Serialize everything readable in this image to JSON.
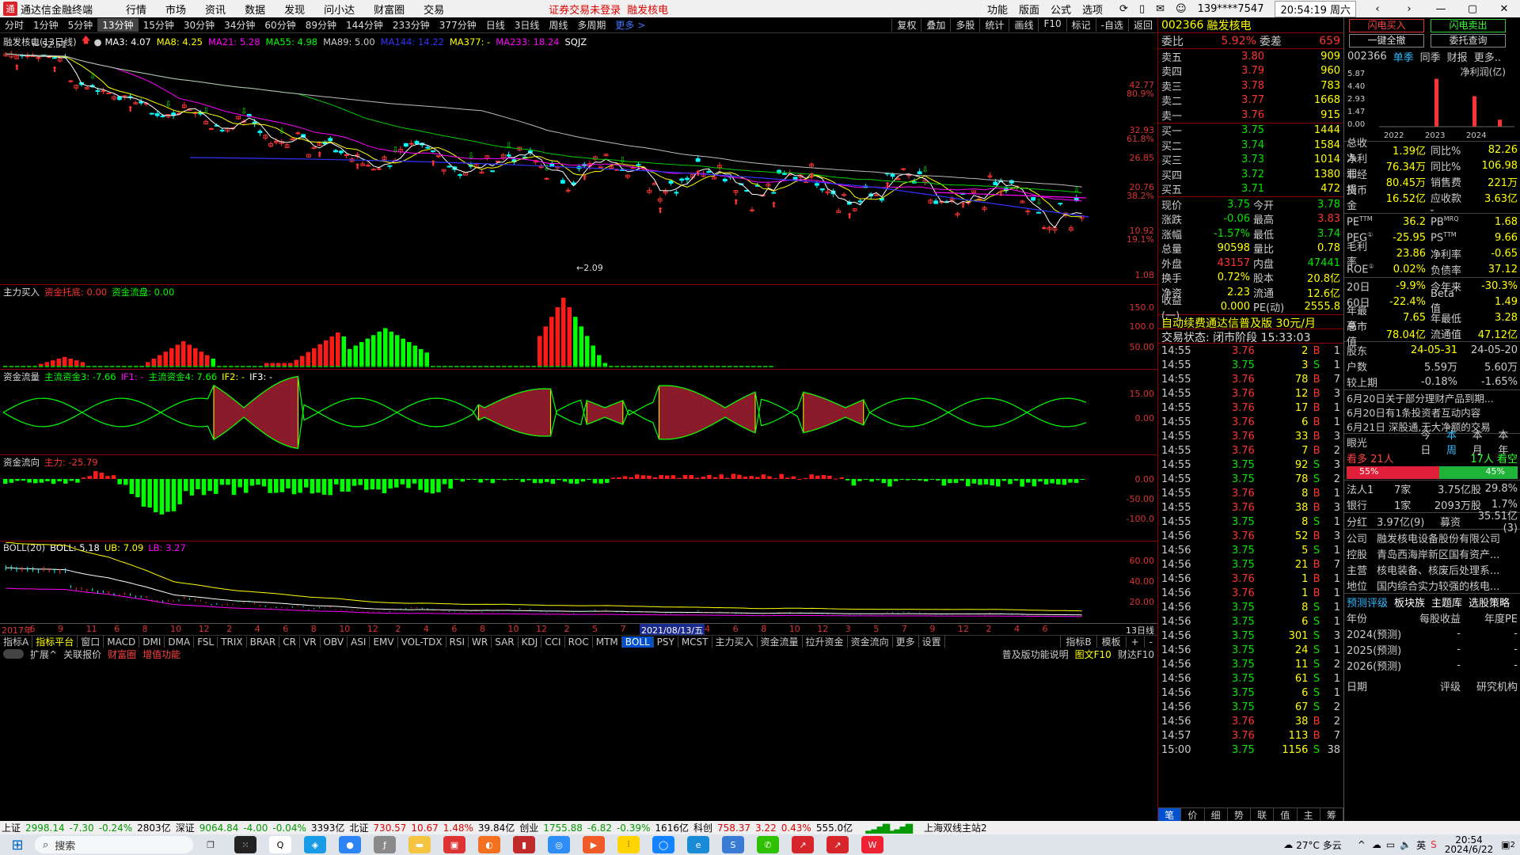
{
  "app": {
    "title": "通达信金融终端",
    "menu": [
      "行情",
      "市场",
      "资讯",
      "数据",
      "发现",
      "问小达",
      "财富圈",
      "交易"
    ],
    "warning": "证券交易未登录",
    "warning_stock": "融发核电",
    "right": [
      "功能",
      "版面",
      "公式",
      "选项"
    ],
    "account": "139****7547",
    "clock": "20:54:19 周六"
  },
  "periods": [
    "分时",
    "1分钟",
    "5分钟",
    "13分钟",
    "15分钟",
    "30分钟",
    "34分钟",
    "60分钟",
    "89分钟",
    "144分钟",
    "233分钟",
    "377分钟",
    "日线",
    "3日线",
    "周线",
    "多周期",
    "更多 >"
  ],
  "period_active": "13分钟",
  "tools": [
    "复权",
    "叠加",
    "多股",
    "统计",
    "画线",
    "F10",
    "标记",
    "-自选",
    "返回"
  ],
  "main": {
    "head_title": "融发核电(13日线)",
    "ma": [
      {
        "t": "MA3: 4.07",
        "c": "#ffffff"
      },
      {
        "t": "MA8: 4.25",
        "c": "#ffff00"
      },
      {
        "t": "MA21: 5.28",
        "c": "#ff00ff"
      },
      {
        "t": "MA55: 4.98",
        "c": "#00ff00"
      },
      {
        "t": "MA89: 5.00",
        "c": "#cccccc"
      },
      {
        "t": "MA144: 14.22",
        "c": "#3333ff"
      },
      {
        "t": "MA377: -",
        "c": "#ffff00"
      },
      {
        "t": "MA233: 18.24",
        "c": "#ff00ff"
      },
      {
        "t": "SQJZ",
        "c": "#ffffff"
      }
    ],
    "high_label": "52.51",
    "low_label": "2.09",
    "yticks": [
      {
        "v": "42.77",
        "p": "80.9%"
      },
      {
        "v": "32.93",
        "p": "61.8%"
      },
      {
        "v": "26.85",
        "p": ""
      },
      {
        "v": "20.76",
        "p": "38.2%"
      },
      {
        "v": "10.92",
        "p": "19.1%"
      },
      {
        "v": "1.08",
        "p": ""
      }
    ]
  },
  "pane2": {
    "title": "主力买入",
    "items": [
      {
        "t": "资金托底: 0.00",
        "c": "#ff3333"
      },
      {
        "t": "资金流盘: 0.00",
        "c": "#00ff00"
      }
    ],
    "yticks": [
      "150.0",
      "100.0",
      "50.00"
    ]
  },
  "pane3": {
    "title": "资金流量",
    "items": [
      {
        "t": "主流资金3: -7.66",
        "c": "#00ff00"
      },
      {
        "t": "IF1: -",
        "c": "#ff00ff"
      },
      {
        "t": "主流资金4: 7.66",
        "c": "#00ff00"
      },
      {
        "t": "IF2: -",
        "c": "#ffff00"
      },
      {
        "t": "IF3: -",
        "c": "#ffffff"
      }
    ],
    "yticks": [
      "15.00",
      "0.00"
    ]
  },
  "pane4": {
    "title": "资金流向",
    "items": [
      {
        "t": "主力: -25.79",
        "c": "#ff3333"
      }
    ],
    "yticks": [
      "0.00",
      "-50.00",
      "-100.0"
    ]
  },
  "pane5": {
    "title": "BOLL(20)",
    "items": [
      {
        "t": "BOLL: 5.18",
        "c": "#ffffff"
      },
      {
        "t": "UB: 7.09",
        "c": "#ffff00"
      },
      {
        "t": "LB: 3.27",
        "c": "#ff00ff"
      }
    ],
    "yticks": [
      "60.00",
      "40.00",
      "20.00"
    ]
  },
  "xaxis": [
    "2017年",
    "6",
    "9",
    "11",
    "6",
    "8",
    "10",
    "12",
    "2",
    "4",
    "6",
    "8",
    "10",
    "12",
    "2",
    "4",
    "6",
    "8",
    "10",
    "12",
    "2",
    "5",
    "7",
    "9",
    "11",
    "4",
    "6",
    "8",
    "10",
    "12",
    "3",
    "5",
    "7",
    "9",
    "12",
    "2",
    "4",
    "6"
  ],
  "xaxis_highlight": "2021/08/13/五",
  "xaxis_unit": "13日线",
  "indicator_tabs": [
    "指标A",
    "指标平台",
    "窗口",
    "MACD",
    "DMI",
    "DMA",
    "FSL",
    "TRIX",
    "BRAR",
    "CR",
    "VR",
    "OBV",
    "ASI",
    "EMV",
    "VOL-TDX",
    "RSI",
    "WR",
    "SAR",
    "KDJ",
    "CCI",
    "ROC",
    "MTM",
    "BOLL",
    "PSY",
    "MCST",
    "主力买入",
    "资金流量",
    "拉升资金",
    "资金流向",
    "更多",
    "设置"
  ],
  "indicator_active": "BOLL",
  "indicator_right": [
    "指标B",
    "模板",
    "+",
    "-"
  ],
  "sub_tabs": [
    "扩展^",
    "关联报价",
    "财富圈",
    "增值功能"
  ],
  "sub_right": [
    "普及版功能说明",
    "图文F10",
    "财达F10"
  ],
  "quote": {
    "code": "002366",
    "name": "融发核电",
    "weibi_label": "委比",
    "weibi": "5.92%",
    "weicha_label": "委差",
    "weicha": "659",
    "asks": [
      {
        "l": "卖五",
        "p": "3.80",
        "v": "909"
      },
      {
        "l": "卖四",
        "p": "3.79",
        "v": "960"
      },
      {
        "l": "卖三",
        "p": "3.78",
        "v": "783"
      },
      {
        "l": "卖二",
        "p": "3.77",
        "v": "1668"
      },
      {
        "l": "卖一",
        "p": "3.76",
        "v": "915"
      }
    ],
    "bids": [
      {
        "l": "买一",
        "p": "3.75",
        "v": "1444"
      },
      {
        "l": "买二",
        "p": "3.74",
        "v": "1584"
      },
      {
        "l": "买三",
        "p": "3.73",
        "v": "1014"
      },
      {
        "l": "买四",
        "p": "3.72",
        "v": "1380"
      },
      {
        "l": "买五",
        "p": "3.71",
        "v": "472"
      }
    ],
    "stats": [
      {
        "k": "现价",
        "v": "3.75",
        "vc": "#00e600",
        "k2": "今开",
        "v2": "3.78",
        "v2c": "#00e600"
      },
      {
        "k": "涨跌",
        "v": "-0.06",
        "vc": "#00e600",
        "k2": "最高",
        "v2": "3.83",
        "v2c": "#ff3333"
      },
      {
        "k": "涨幅",
        "v": "-1.57%",
        "vc": "#00e600",
        "k2": "最低",
        "v2": "3.74",
        "v2c": "#00e600"
      },
      {
        "k": "总量",
        "v": "90598",
        "vc": "#ffff00",
        "k2": "量比",
        "v2": "0.78",
        "v2c": "#ffff00"
      },
      {
        "k": "外盘",
        "v": "43157",
        "vc": "#ff3333",
        "k2": "内盘",
        "v2": "47441",
        "v2c": "#00e600"
      },
      {
        "k": "换手",
        "v": "0.72%",
        "vc": "#ffff00",
        "k2": "股本",
        "v2": "20.8亿",
        "v2c": "#ffff00"
      },
      {
        "k": "净资",
        "v": "2.23",
        "vc": "#ffff00",
        "k2": "流通",
        "v2": "12.6亿",
        "v2c": "#ffff00"
      },
      {
        "k": "收益(一)",
        "v": "0.000",
        "vc": "#ffff00",
        "k2": "PE(动)",
        "v2": "2555.8",
        "v2c": "#ffff00"
      }
    ],
    "banner": "自动续费通达信普及版  30元/月",
    "trade_status": "交易状态: 闭市阶段 15:33:03",
    "ticks": [
      {
        "t": "14:55",
        "p": "3.76",
        "v": "2",
        "d": "B",
        "n": "1"
      },
      {
        "t": "14:55",
        "p": "3.75",
        "v": "3",
        "d": "S",
        "n": "1"
      },
      {
        "t": "14:55",
        "p": "3.76",
        "v": "78",
        "d": "B",
        "n": "7"
      },
      {
        "t": "14:55",
        "p": "3.76",
        "v": "12",
        "d": "B",
        "n": "3"
      },
      {
        "t": "14:55",
        "p": "3.76",
        "v": "17",
        "d": "B",
        "n": "1"
      },
      {
        "t": "14:55",
        "p": "3.76",
        "v": "6",
        "d": "B",
        "n": "1"
      },
      {
        "t": "14:55",
        "p": "3.76",
        "v": "33",
        "d": "B",
        "n": "3"
      },
      {
        "t": "14:55",
        "p": "3.76",
        "v": "7",
        "d": "B",
        "n": "2"
      },
      {
        "t": "14:55",
        "p": "3.75",
        "v": "92",
        "d": "S",
        "n": "3"
      },
      {
        "t": "14:55",
        "p": "3.75",
        "v": "78",
        "d": "S",
        "n": "2"
      },
      {
        "t": "14:55",
        "p": "3.76",
        "v": "8",
        "d": "B",
        "n": "1"
      },
      {
        "t": "14:55",
        "p": "3.76",
        "v": "38",
        "d": "B",
        "n": "3"
      },
      {
        "t": "14:55",
        "p": "3.75",
        "v": "8",
        "d": "S",
        "n": "1"
      },
      {
        "t": "14:56",
        "p": "3.76",
        "v": "52",
        "d": "B",
        "n": "3"
      },
      {
        "t": "14:56",
        "p": "3.75",
        "v": "5",
        "d": "S",
        "n": "1"
      },
      {
        "t": "14:56",
        "p": "3.75",
        "v": "21",
        "d": "B",
        "n": "7"
      },
      {
        "t": "14:56",
        "p": "3.76",
        "v": "1",
        "d": "B",
        "n": "1"
      },
      {
        "t": "14:56",
        "p": "3.76",
        "v": "1",
        "d": "B",
        "n": "1"
      },
      {
        "t": "14:56",
        "p": "3.75",
        "v": "8",
        "d": "S",
        "n": "1"
      },
      {
        "t": "14:56",
        "p": "3.75",
        "v": "6",
        "d": "S",
        "n": "1"
      },
      {
        "t": "14:56",
        "p": "3.75",
        "v": "301",
        "d": "S",
        "n": "3"
      },
      {
        "t": "14:56",
        "p": "3.75",
        "v": "24",
        "d": "S",
        "n": "1"
      },
      {
        "t": "14:56",
        "p": "3.75",
        "v": "11",
        "d": "S",
        "n": "2"
      },
      {
        "t": "14:56",
        "p": "3.75",
        "v": "61",
        "d": "S",
        "n": "1"
      },
      {
        "t": "14:56",
        "p": "3.75",
        "v": "6",
        "d": "S",
        "n": "1"
      },
      {
        "t": "14:56",
        "p": "3.75",
        "v": "67",
        "d": "S",
        "n": "2"
      },
      {
        "t": "14:56",
        "p": "3.76",
        "v": "38",
        "d": "B",
        "n": "2"
      },
      {
        "t": "14:57",
        "p": "3.76",
        "v": "113",
        "d": "B",
        "n": "7"
      },
      {
        "t": "15:00",
        "p": "3.75",
        "v": "1156",
        "d": "S",
        "n": "38"
      }
    ],
    "bottom_tabs": [
      "笔",
      "价",
      "细",
      "势",
      "联",
      "值",
      "主",
      "筹"
    ]
  },
  "far": {
    "buttons": [
      "闪电买入",
      "闪电卖出",
      "一键全撤",
      "委托查询"
    ],
    "tabs": [
      "002366",
      "单季",
      "同季",
      "财报",
      "更多.."
    ],
    "chart_title": "净利润(亿)",
    "chart_y": [
      "5.87",
      "4.40",
      "2.93",
      "1.47",
      "0.00"
    ],
    "chart_x": [
      "2022",
      "2023",
      "2024"
    ],
    "fin": [
      {
        "k": "总收入",
        "v": "1.39亿",
        "k2": "同比%",
        "v2": "82.26"
      },
      {
        "k": "净利润",
        "v": "76.34万",
        "k2": "同比%",
        "v2": "106.98"
      },
      {
        "k": "非经损",
        "v": "80.45万",
        "k2": "销售费",
        "v2": "221万"
      },
      {
        "k": "货币金",
        "v": "16.52亿",
        "k2": "应收款",
        "v2": "3.63亿"
      }
    ],
    "val": [
      {
        "k": "PE",
        "sup": "TTM",
        "v": "36.2",
        "k2": "PB",
        "sup2": "MRQ",
        "v2": "1.68"
      },
      {
        "k": "PEG",
        "sup": "①",
        "v": "-25.95",
        "k2": "PS",
        "sup2": "TTM",
        "v2": "9.66"
      },
      {
        "k": "毛利率",
        "sup": "",
        "v": "23.86",
        "k2": "净利率",
        "sup2": "",
        "v2": "-0.65"
      },
      {
        "k": "ROE",
        "sup": "①",
        "v": "0.02%",
        "k2": "负债率",
        "sup2": "",
        "v2": "37.12"
      }
    ],
    "perf": [
      {
        "k": "20日",
        "v": "-9.9%",
        "k2": "今年来",
        "v2": "-30.3%"
      },
      {
        "k": "60日",
        "v": "-22.4%",
        "k2": "Beta值",
        "v2": "1.49"
      },
      {
        "k": "年最高",
        "v": "7.65",
        "k2": "年最低",
        "v2": "3.28"
      },
      {
        "k": "总市值",
        "v": "78.04亿",
        "k2": "流通值",
        "v2": "47.12亿"
      }
    ],
    "holders": {
      "k": "股东",
      "d1": "24-05-31",
      "d2": "24-05-20",
      "rows": [
        {
          "k": "户数",
          "v1": "5.59万",
          "v2": "5.60万"
        },
        {
          "k": "较上期",
          "v1": "-0.18%",
          "v2": "-1.65%"
        }
      ]
    },
    "news": [
      "6月20日关于部分理财产品到期...",
      "6月20日有1条投资者互动内容",
      "6月21日 深股通,无大净额的交易"
    ],
    "eye": {
      "label": "眼光",
      "tabs": [
        "今日",
        "本周",
        "本月",
        "本年"
      ],
      "bull": "看多 21人",
      "bear": "17人 看空",
      "bull_pct": "55%",
      "bear_pct": "45%"
    },
    "inst": [
      {
        "k": "法人1",
        "v": "7家",
        "v2": "3.75亿股",
        "v3": "29.8%"
      },
      {
        "k": "银行",
        "v": "1家",
        "v2": "2093万股",
        "v3": "1.7%"
      }
    ],
    "fenhong": {
      "k": "分红",
      "v": "3.97亿(9)",
      "k2": "募资",
      "v2": "35.51亿(3)"
    },
    "company": [
      {
        "k": "公司",
        "v": "融发核电设备股份有限公司"
      },
      {
        "k": "控股",
        "v": "青岛西海岸新区国有资产..."
      },
      {
        "k": "主营",
        "v": "核电装备、核废后处理系..."
      },
      {
        "k": "地位",
        "v": "国内综合实力较强的核电..."
      }
    ],
    "forecast_tabs": [
      "预测评级",
      "板块族",
      "主题库",
      "选股策略"
    ],
    "forecast_head": [
      "年份",
      "每股收益",
      "年度PE"
    ],
    "forecast_rows": [
      {
        "y": "2024(预测)",
        "e": "-",
        "p": "-"
      },
      {
        "y": "2025(预测)",
        "e": "-",
        "p": "-"
      },
      {
        "y": "2026(预测)",
        "e": "-",
        "p": "-"
      }
    ],
    "rating_head": [
      "日期",
      "评级",
      "研究机构"
    ]
  },
  "status": {
    "items": [
      {
        "t": "上证",
        "c": "#000"
      },
      {
        "t": "2998.14",
        "c": "#090"
      },
      {
        "t": "-7.30",
        "c": "#090"
      },
      {
        "t": "-0.24%",
        "c": "#090"
      },
      {
        "t": "2803亿",
        "c": "#000"
      },
      {
        "t": "深证",
        "c": "#000"
      },
      {
        "t": "9064.84",
        "c": "#090"
      },
      {
        "t": "-4.00",
        "c": "#090"
      },
      {
        "t": "-0.04%",
        "c": "#090"
      },
      {
        "t": "3393亿",
        "c": "#000"
      },
      {
        "t": "北证",
        "c": "#000"
      },
      {
        "t": "730.57",
        "c": "#d00"
      },
      {
        "t": "10.67",
        "c": "#d00"
      },
      {
        "t": "1.48%",
        "c": "#d00"
      },
      {
        "t": "39.84亿",
        "c": "#000"
      },
      {
        "t": "创业",
        "c": "#000"
      },
      {
        "t": "1755.88",
        "c": "#090"
      },
      {
        "t": "-6.82",
        "c": "#090"
      },
      {
        "t": "-0.39%",
        "c": "#090"
      },
      {
        "t": "1616亿",
        "c": "#000"
      },
      {
        "t": "科创",
        "c": "#000"
      },
      {
        "t": "758.37",
        "c": "#d00"
      },
      {
        "t": "3.22",
        "c": "#d00"
      },
      {
        "t": "0.43%",
        "c": "#d00"
      },
      {
        "t": "555.0亿",
        "c": "#000"
      }
    ],
    "server": "上海双线主站2"
  },
  "taskbar": {
    "search": "搜索",
    "weather": "27°C 多云",
    "ime": "英",
    "time": "20:54",
    "date": "2024/6/22",
    "notif": "2"
  }
}
